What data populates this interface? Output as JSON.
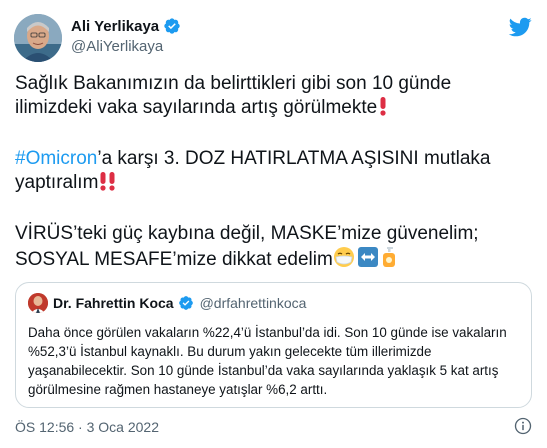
{
  "author": {
    "name": "Ali Yerlikaya",
    "handle": "@AliYerlikaya"
  },
  "tweet": {
    "line1": "Sağlık Bakanımızın da belirttikleri gibi son 10 günde ilimizdeki vaka sayılarında artış görülmekte",
    "hashtag": "#Omicron",
    "line2_rest": "’a karşı 3. DOZ HATIRLATMA AŞISINI mutlaka yaptıralım",
    "line3": "VİRÜS’teki güç kaybına değil, MASKE’mize güvenelim; SOSYAL MESAFE’mize dikkat edelim"
  },
  "quote": {
    "name": "Dr. Fahrettin Koca",
    "handle": "@drfahrettinkoca",
    "text": "Daha önce görülen vakaların %22,4’ü İstanbul’da idi. Son 10 günde ise vakaların %52,3’ü İstanbul kaynaklı. Bu durum yakın gelecekte tüm illerimizde yaşanabilecektir. Son 10 günde İstanbul’da vaka sayılarında yaklaşık 5 kat artış görülmesine rağmen hastaneye yatışlar %6,2 arttı."
  },
  "timestamp": "ÖS 12:56 · 3 Oca 2022",
  "colors": {
    "link": "#1d9bf0",
    "text": "#0f1419",
    "muted": "#536471",
    "border": "#cfd9de"
  },
  "icons": [
    "twitter-bird-icon",
    "verified-badge-icon",
    "info-icon",
    "exclamation-emoji",
    "double-exclamation-emoji",
    "mask-emoji",
    "left-right-arrow-emoji",
    "hand-sanitizer-emoji"
  ]
}
